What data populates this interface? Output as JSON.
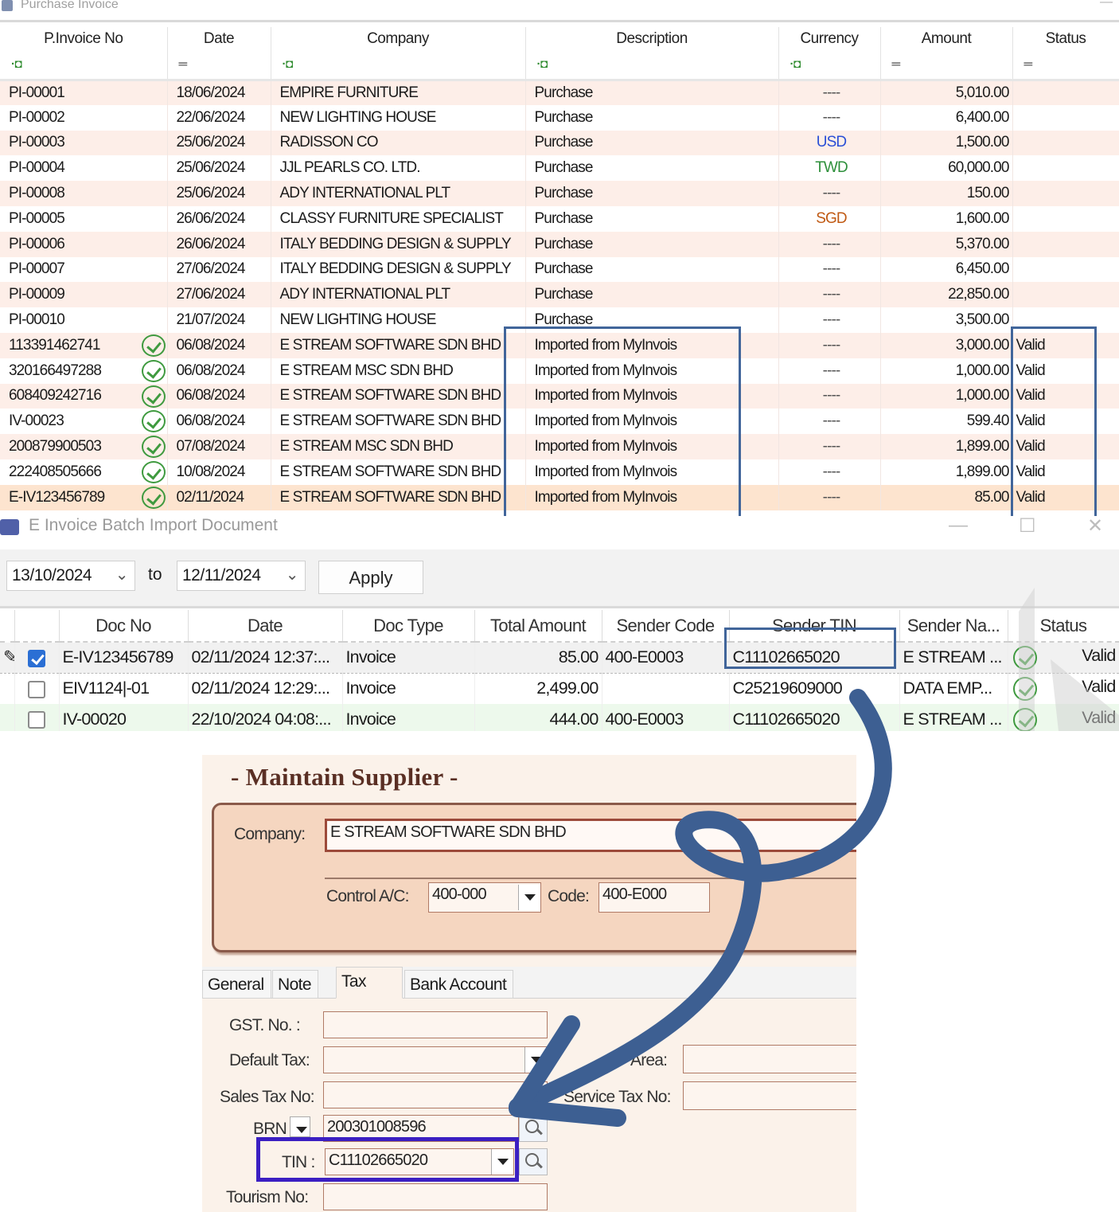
{
  "purchase_invoice": {
    "title": "Purchase Invoice",
    "columns": [
      "P.Invoice No",
      "Date",
      "Company",
      "Description",
      "Currency",
      "Amount",
      "Status"
    ],
    "rows": [
      {
        "no": "PI-00001",
        "date": "18/06/2024",
        "company": "EMPIRE FURNITURE",
        "desc": "Purchase",
        "cur": "----",
        "amount": "5,010.00",
        "status": "",
        "ok": false
      },
      {
        "no": "PI-00002",
        "date": "22/06/2024",
        "company": "NEW LIGHTING HOUSE",
        "desc": "Purchase",
        "cur": "----",
        "amount": "6,400.00",
        "status": "",
        "ok": false
      },
      {
        "no": "PI-00003",
        "date": "25/06/2024",
        "company": "RADISSON CO",
        "desc": "Purchase",
        "cur": "USD",
        "amount": "1,500.00",
        "status": "",
        "ok": false
      },
      {
        "no": "PI-00004",
        "date": "25/06/2024",
        "company": "JJL PEARLS CO. LTD.",
        "desc": "Purchase",
        "cur": "TWD",
        "amount": "60,000.00",
        "status": "",
        "ok": false
      },
      {
        "no": "PI-00008",
        "date": "25/06/2024",
        "company": "ADY INTERNATIONAL PLT",
        "desc": "Purchase",
        "cur": "----",
        "amount": "150.00",
        "status": "",
        "ok": false
      },
      {
        "no": "PI-00005",
        "date": "26/06/2024",
        "company": "CLASSY FURNITURE SPECIALIST",
        "desc": "Purchase",
        "cur": "SGD",
        "amount": "1,600.00",
        "status": "",
        "ok": false
      },
      {
        "no": "PI-00006",
        "date": "26/06/2024",
        "company": "ITALY BEDDING DESIGN & SUPPLY",
        "desc": "Purchase",
        "cur": "----",
        "amount": "5,370.00",
        "status": "",
        "ok": false
      },
      {
        "no": "PI-00007",
        "date": "27/06/2024",
        "company": "ITALY BEDDING DESIGN & SUPPLY",
        "desc": "Purchase",
        "cur": "----",
        "amount": "6,450.00",
        "status": "",
        "ok": false
      },
      {
        "no": "PI-00009",
        "date": "27/06/2024",
        "company": "ADY INTERNATIONAL PLT",
        "desc": "Purchase",
        "cur": "----",
        "amount": "22,850.00",
        "status": "",
        "ok": false
      },
      {
        "no": "PI-00010",
        "date": "21/07/2024",
        "company": "NEW LIGHTING HOUSE",
        "desc": "Purchase",
        "cur": "----",
        "amount": "3,500.00",
        "status": "",
        "ok": false
      },
      {
        "no": "113391462741",
        "date": "06/08/2024",
        "company": "E STREAM SOFTWARE SDN BHD",
        "desc": "Imported from MyInvois",
        "cur": "----",
        "amount": "3,000.00",
        "status": "Valid",
        "ok": true
      },
      {
        "no": "320166497288",
        "date": "06/08/2024",
        "company": "E STREAM MSC SDN BHD",
        "desc": "Imported from MyInvois",
        "cur": "----",
        "amount": "1,000.00",
        "status": "Valid",
        "ok": true
      },
      {
        "no": "608409242716",
        "date": "06/08/2024",
        "company": "E STREAM SOFTWARE SDN BHD",
        "desc": "Imported from MyInvois",
        "cur": "----",
        "amount": "1,000.00",
        "status": "Valid",
        "ok": true
      },
      {
        "no": "IV-00023",
        "date": "06/08/2024",
        "company": "E STREAM SOFTWARE SDN BHD",
        "desc": "Imported from MyInvois",
        "cur": "----",
        "amount": "599.40",
        "status": "Valid",
        "ok": true
      },
      {
        "no": "200879900503",
        "date": "07/08/2024",
        "company": "E STREAM MSC SDN BHD",
        "desc": "Imported from MyInvois",
        "cur": "----",
        "amount": "1,899.00",
        "status": "Valid",
        "ok": true
      },
      {
        "no": "222408505666",
        "date": "10/08/2024",
        "company": "E STREAM SOFTWARE SDN BHD",
        "desc": "Imported from MyInvois",
        "cur": "----",
        "amount": "1,899.00",
        "status": "Valid",
        "ok": true
      },
      {
        "no": "E-IV123456789",
        "date": "02/11/2024",
        "company": "E STREAM SOFTWARE SDN BHD",
        "desc": "Imported from MyInvois",
        "cur": "----",
        "amount": "85.00",
        "status": "Valid",
        "ok": true
      }
    ]
  },
  "batch_import": {
    "title": "E Invoice Batch Import Document",
    "date_from": "13/10/2024",
    "to_label": "to",
    "date_to": "12/11/2024",
    "apply_label": "Apply",
    "columns": [
      "Doc No",
      "Date",
      "Doc Type",
      "Total Amount",
      "Sender Code",
      "Sender TIN",
      "Sender Na...",
      "Status"
    ],
    "rows": [
      {
        "checked": true,
        "doc_no": "E-IV123456789",
        "date": "02/11/2024 12:37:...",
        "type": "Invoice",
        "total": "85.00",
        "sender_code": "400-E0003",
        "tin": "C11102665020",
        "name": "E STREAM ...",
        "status": "Valid"
      },
      {
        "checked": false,
        "doc_no": "EIV1124|-01",
        "date": "02/11/2024 12:29:...",
        "type": "Invoice",
        "total": "2,499.00",
        "sender_code": "",
        "tin": "C25219609000",
        "name": "DATA EMP...",
        "status": "Valid"
      },
      {
        "checked": false,
        "doc_no": "IV-00020",
        "date": "22/10/2024 04:08:...",
        "type": "Invoice",
        "total": "444.00",
        "sender_code": "400-E0003",
        "tin": "C11102665020",
        "name": "E STREAM ...",
        "status": "Valid"
      }
    ]
  },
  "maintain_supplier": {
    "title": "- Maintain Supplier -",
    "company_label": "Company:",
    "company_value": "E STREAM SOFTWARE SDN BHD",
    "control_ac_label": "Control A/C:",
    "control_ac_value": "400-000",
    "code_label": "Code:",
    "code_value": "400-E000",
    "tabs": [
      "General",
      "Note",
      "Tax",
      "Bank Account"
    ],
    "gst_label": "GST. No. :",
    "default_tax_label": "Default Tax:",
    "area_label": "Area:",
    "sales_tax_label": "Sales Tax No:",
    "service_tax_label": "Service Tax No:",
    "brn_label": "BRN",
    "brn_value": "200301008596",
    "tin_label": "TIN :",
    "tin_value": "C11102665020",
    "tourism_label": "Tourism No:"
  },
  "colors": {
    "highlight_blue": "#41659a",
    "tin_highlight": "#3b1fc2",
    "row_pink": "#fdeee8",
    "valid_green": "#3f9a3f"
  }
}
